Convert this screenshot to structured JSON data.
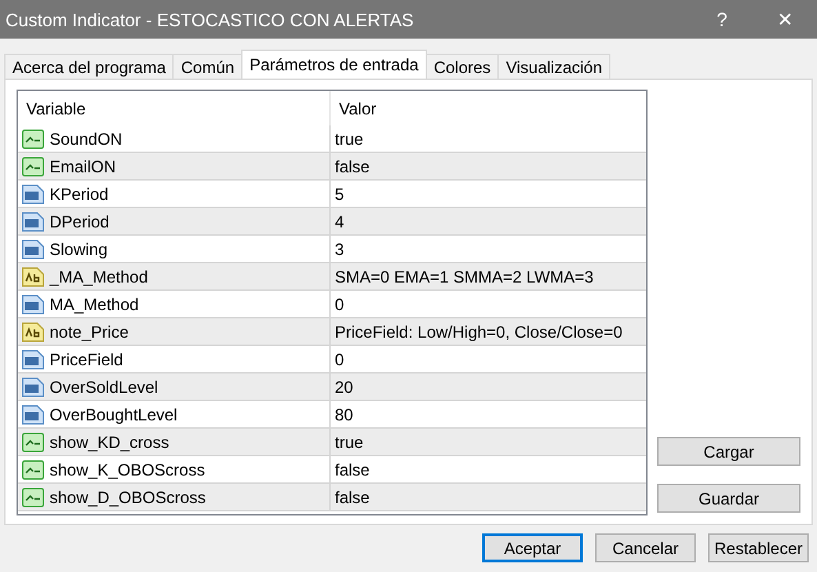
{
  "window": {
    "title": "Custom Indicator - ESTOCASTICO CON ALERTAS",
    "help_button": "?",
    "close_button": "✕"
  },
  "tabs": [
    {
      "label": "Acerca del programa",
      "selected": false
    },
    {
      "label": "Común",
      "selected": false
    },
    {
      "label": "Parámetros de entrada",
      "selected": true
    },
    {
      "label": "Colores",
      "selected": false
    },
    {
      "label": "Visualización",
      "selected": false
    }
  ],
  "table": {
    "columns": [
      "Variable",
      "Valor"
    ],
    "rows": [
      {
        "kind": "bool",
        "variable": "SoundON",
        "value": "true"
      },
      {
        "kind": "bool",
        "variable": "EmailON",
        "value": "false"
      },
      {
        "kind": "int",
        "variable": "KPeriod",
        "value": "5"
      },
      {
        "kind": "int",
        "variable": "DPeriod",
        "value": "4"
      },
      {
        "kind": "int",
        "variable": "Slowing",
        "value": "3"
      },
      {
        "kind": "string",
        "variable": "_MA_Method",
        "value": "SMA=0 EMA=1 SMMA=2 LWMA=3"
      },
      {
        "kind": "int",
        "variable": "MA_Method",
        "value": "0"
      },
      {
        "kind": "string",
        "variable": "note_Price",
        "value": "PriceField: Low/High=0, Close/Close=0"
      },
      {
        "kind": "int",
        "variable": "PriceField",
        "value": "0"
      },
      {
        "kind": "int",
        "variable": "OverSoldLevel",
        "value": "20"
      },
      {
        "kind": "int",
        "variable": "OverBoughtLevel",
        "value": "80"
      },
      {
        "kind": "bool",
        "variable": "show_KD_cross",
        "value": "true"
      },
      {
        "kind": "bool",
        "variable": "show_K_OBOScross",
        "value": "false"
      },
      {
        "kind": "bool",
        "variable": "show_D_OBOScross",
        "value": "false"
      }
    ]
  },
  "side_buttons": [
    "Cargar",
    "Guardar"
  ],
  "buttons": [
    {
      "label": "Aceptar",
      "default": true
    },
    {
      "label": "Cancelar",
      "default": false
    },
    {
      "label": "Restablecer",
      "default": false
    }
  ]
}
